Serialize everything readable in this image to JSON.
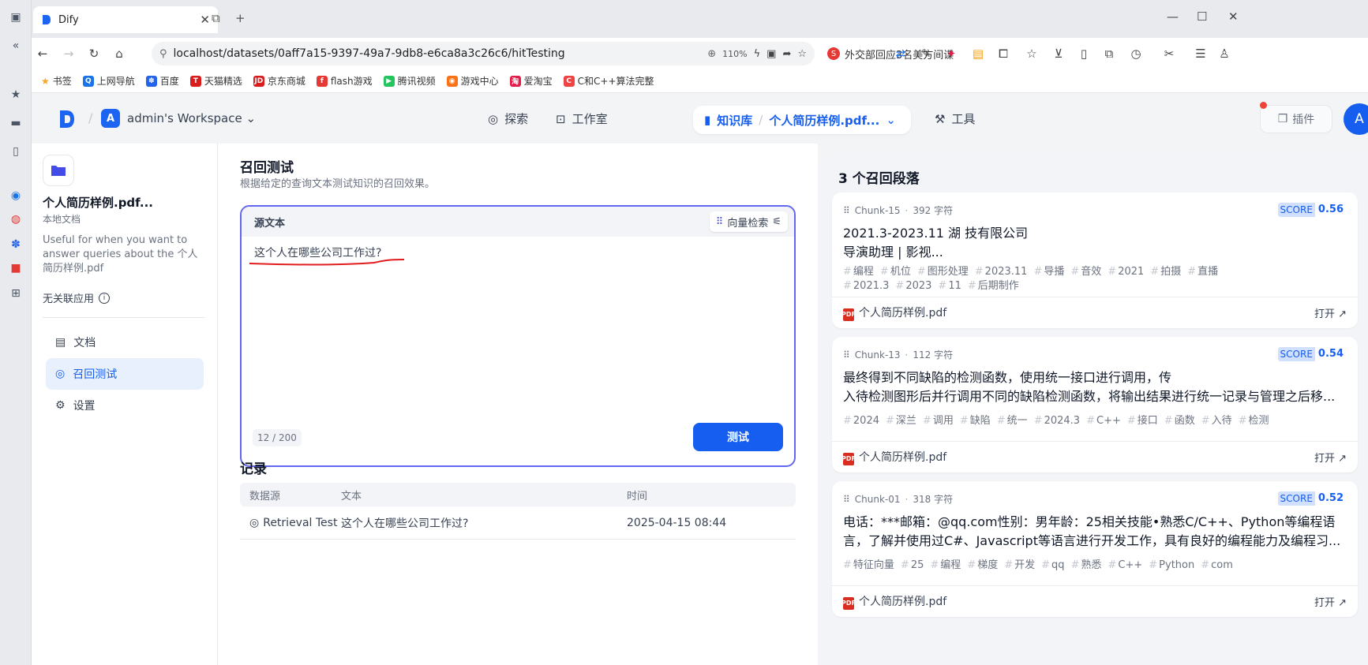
{
  "browser": {
    "tab_title": "Dify",
    "url": "localhost/datasets/0aff7a15-9397-49a7-9db8-e6ca8a3c26c6/hitTesting",
    "zoom": "110%",
    "news_text": "外交部回应3名美方间谍",
    "bookmarks": [
      "书签",
      "上网导航",
      "百度",
      "天猫精选",
      "京东商城",
      "flash游戏",
      "腾讯视频",
      "游戏中心",
      "爱淘宝",
      "C和C++算法完整"
    ]
  },
  "header": {
    "workspace_initial": "A",
    "workspace_name": "admin's Workspace",
    "nav_explore": "探索",
    "nav_studio": "工作室",
    "nav_knowledge": "知识库",
    "nav_current_dataset": "个人简历样例.pdf...",
    "nav_tools": "工具",
    "plugin_label": "插件",
    "user_initial": "A"
  },
  "dataset": {
    "name": "个人简历样例.pdf...",
    "type": "本地文档",
    "description": "Useful for when you want to answer queries about the 个人简历样例.pdf",
    "apps_label": "无关联应用",
    "nav": [
      "文档",
      "召回测试",
      "设置"
    ]
  },
  "retrieval": {
    "title": "召回测试",
    "subtitle": "根据给定的查询文本测试知识的召回效果。",
    "source_label": "源文本",
    "method_label": "向量检索",
    "query": "这个人在哪些公司工作过?",
    "count": "12",
    "max": "200",
    "test_button": "测试"
  },
  "records": {
    "title": "记录",
    "headers": [
      "数据源",
      "文本",
      "时间"
    ],
    "rows": [
      {
        "source": "Retrieval Test",
        "text": "这个人在哪些公司工作过?",
        "time": "2025-04-15 08:44"
      }
    ]
  },
  "results": {
    "title": "3 个召回段落",
    "score_label": "SCORE",
    "open_label": "打开",
    "chunks": [
      {
        "id": "Chunk-15",
        "chars": "392 字符",
        "score": "0.56",
        "text_line1": "2021.3-2023.11 湖          技有限公司",
        "text_line2": "导演助理 | 影视...",
        "tags": [
          "编程",
          "机位",
          "图形处理",
          "2023.11",
          "导播",
          "音效",
          "2021",
          "拍摄",
          "直播",
          "2021.3",
          "2023",
          "11",
          "后期制作"
        ],
        "file": "个人简历样例.pdf"
      },
      {
        "id": "Chunk-13",
        "chars": "112 字符",
        "score": "0.54",
        "text_line1": "最终得到不同缺陷的检测函数，使用统一接口进行调用，传",
        "text_line2": "入待检测图形后并行调用不同的缺陷检测函数，将输出结果进行统一记录与管理之后移...",
        "tags": [
          "2024",
          "深兰",
          "调用",
          "缺陷",
          "统一",
          "2024.3",
          "C++",
          "接口",
          "函数",
          "入待",
          "检测"
        ],
        "file": "个人简历样例.pdf"
      },
      {
        "id": "Chunk-01",
        "chars": "318 字符",
        "score": "0.52",
        "text_line1": "电话：***邮箱：@qq.com性别：男年龄：25相关技能•熟悉C/C++、Python等编程语",
        "text_line2": "言，了解并使用过C#、Javascript等语言进行开发工作，具有良好的编程能力及编程习...",
        "tags": [
          "特征向量",
          "25",
          "编程",
          "梯度",
          "开发",
          "qq",
          "熟悉",
          "C++",
          "Python",
          "com"
        ],
        "file": "个人简历样例.pdf"
      }
    ]
  }
}
